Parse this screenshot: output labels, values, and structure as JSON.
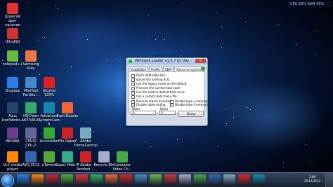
{
  "desktop_icons": [
    {
      "label": "Дорогой друг\nнасоник",
      "color": "#d33"
    },
    {
      "label": "UltraISO",
      "color": "#c33"
    },
    {
      "label": "notepad++",
      "color": "#6b4"
    },
    {
      "label": "Samsung\nKies",
      "color": "#e74"
    },
    {
      "label": "Dropbox",
      "color": "#2b7de9"
    },
    {
      "label": "MiniTool\nPartitio...",
      "color": "#48c"
    },
    {
      "label": "Alcohol\n120%",
      "color": "#d22"
    },
    {
      "label": "Asus\nIconWorks...",
      "color": "#246"
    },
    {
      "label": "HDClean\nANTIVIRUS",
      "color": "#3a6"
    },
    {
      "label": "Advanced\nSystemCare 6",
      "color": "#18a"
    },
    {
      "label": "Foxit Reader",
      "color": "#e63"
    },
    {
      "label": "WinRAR",
      "color": "#6a3d8c"
    },
    {
      "label": "CPUID\nCPU-Z",
      "color": "#669"
    },
    {
      "label": "Uninstaller",
      "color": "#3a3"
    },
    {
      "label": "File Repair",
      "color": "#c22"
    },
    {
      "label": "Adobe\nFormsCentral",
      "color": "#7ab"
    },
    {
      "label": "VLC media\nplayer",
      "color": "#f80"
    },
    {
      "label": "AVG 2012",
      "color": "#36a"
    },
    {
      "label": "uTorrent",
      "color": "#5a3"
    },
    {
      "label": "Super Hide IP",
      "color": "#3a8"
    },
    {
      "label": "Adobe\nAcrobat ...",
      "color": "#c22"
    },
    {
      "label": "Recycle Bin",
      "color": "#aac"
    },
    {
      "label": "Camtasia\nVideo Ch...",
      "color": "#4a4"
    }
  ],
  "cpu_widget": "CPU 28%   RAM 45%",
  "window": {
    "title": "Windows Loader v1.9.7 by Daz",
    "min_glyph": "–",
    "close_glyph": "x",
    "tabs": [
      {
        "label": "Installation"
      },
      {
        "label": "Profile"
      },
      {
        "label": "OEM"
      },
      {
        "label": "Advanced options"
      }
    ],
    "options": [
      {
        "label": "Patch OEM table ID's"
      },
      {
        "label": "Ignore the existing SLIC"
      },
      {
        "label": "Use the legacy mode as the default"
      },
      {
        "label": "Preserve the current boot code"
      },
      {
        "label": "Use the loaders default boot menu"
      },
      {
        "label": "Use a custom boot menu file"
      }
    ],
    "options_lower_left": [
      {
        "label": "Reverse search direction"
      },
      {
        "label": "Disable table sorting"
      }
    ],
    "options_lower_right": [
      {
        "label": "Disable type 3 memory"
      },
      {
        "label": "Disable type 4 memory"
      }
    ],
    "tables_label": "Tables",
    "bytes_label": "Bytes",
    "tables_value": "0",
    "bytes_value": "0",
    "dump_label": "Dump"
  },
  "taskbar": {
    "pinned_colors": [
      "#2b7de9",
      "#f80",
      "#c22",
      "#5a3",
      "#d33",
      "#3a6",
      "#e63",
      "#c22",
      "#48c",
      "#6b4",
      "#c33",
      "#aac",
      "#4a4",
      "#36a",
      "#7ab",
      "#d22",
      "#18a"
    ],
    "time": "3:08",
    "date": "25/12/2012"
  }
}
